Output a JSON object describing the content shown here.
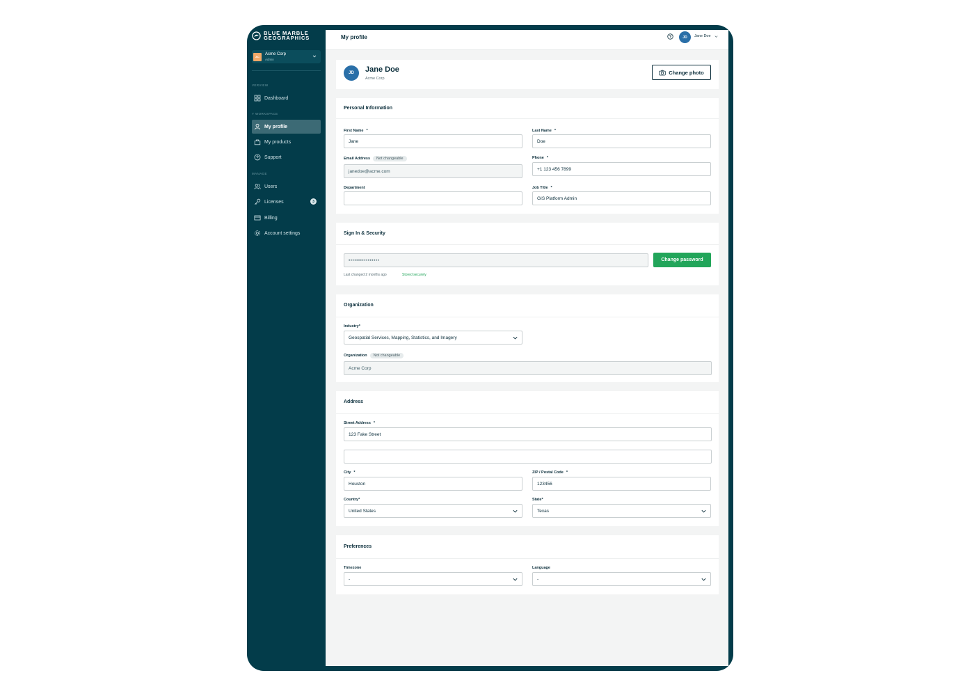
{
  "brand": {
    "line1": "BLUE MARBLE",
    "line2": "GEOGRAPHICS"
  },
  "org_switcher": {
    "initials": "AC",
    "name": "Acme Corp",
    "role": "Admin"
  },
  "sidebar": {
    "sections": {
      "overview": "VERVIEW",
      "workspace": "Y WORKSPACE",
      "manage": "MANAGE"
    },
    "items": [
      {
        "label": "Dashboard",
        "icon": "grid-icon"
      },
      {
        "label": "My profile",
        "icon": "user-icon",
        "active": true
      },
      {
        "label": "My products",
        "icon": "bag-icon"
      },
      {
        "label": "Support",
        "icon": "help-circle-icon"
      },
      {
        "label": "Users",
        "icon": "users-icon"
      },
      {
        "label": "Licenses",
        "icon": "key-icon",
        "badge": "3"
      },
      {
        "label": "Billing",
        "icon": "card-icon"
      },
      {
        "label": "Account settings",
        "icon": "gear-icon"
      }
    ]
  },
  "topbar": {
    "title": "My profile",
    "user_initials": "JD",
    "user_name": "Jane Doe"
  },
  "profile": {
    "initials": "JD",
    "name": "Jane Doe",
    "org": "Acme Corp",
    "change_photo": "Change photo"
  },
  "personal": {
    "title": "Personal Information",
    "first_name_label": "First Name",
    "first_name": "Jane",
    "last_name_label": "Last Name",
    "last_name": "Doe",
    "email_label": "Email Address",
    "email_pill": "Not changeable",
    "email": "janedoe@acme.com",
    "phone_label": "Phone",
    "phone": "+1 123 456 7899",
    "department_label": "Department",
    "department": "",
    "job_title_label": "Job Title",
    "job_title": "GIS Platform Admin",
    "required_mark": "*"
  },
  "security": {
    "title": "Sign In & Security",
    "password_mask": "••••••••••••••••",
    "change_password": "Change password",
    "last_changed": "Last changed 2 months ago",
    "stored": "Stored securely"
  },
  "organization": {
    "title": "Organization",
    "industry_label": "Industry*",
    "industry": "Geospatial Services, Mapping, Statistics, and Imagery",
    "org_label": "Organization",
    "org_pill": "Not changeable",
    "org": "Acme Corp"
  },
  "address": {
    "title": "Address",
    "street_label": "Street Address",
    "street": "123 Fake Street",
    "street2": "",
    "city_label": "City",
    "city": "Houston",
    "zip_label": "ZIP / Postal Code",
    "zip": "123456",
    "country_label": "Country*",
    "country": "United States",
    "state_label": "State*",
    "state": "Texas"
  },
  "preferences": {
    "title": "Preferences",
    "timezone_label": "Timezone",
    "timezone": "-",
    "language_label": "Language",
    "language": "-"
  }
}
